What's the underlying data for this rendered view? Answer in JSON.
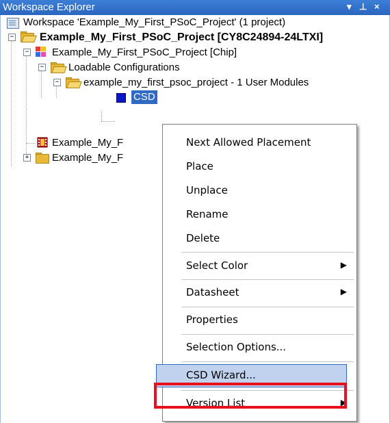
{
  "window": {
    "title": "Workspace Explorer",
    "pin_glyph": "▾",
    "dock_glyph": "p",
    "close_glyph": "×"
  },
  "tree": {
    "workspace": "Workspace 'Example_My_First_PSoC_Project' (1 project)",
    "project": "Example_My_First_PSoC_Project [CY8C24894-24LTXI]",
    "chip": "Example_My_First_PSoC_Project [Chip]",
    "loadable_configurations": "Loadable Configurations",
    "configuration": "example_my_first_psoc_project - 1 User Modules",
    "module": "CSD",
    "item_film": "Example_My_F",
    "item_folder": "Example_My_F"
  },
  "menu": {
    "items": [
      {
        "label": "Next Allowed Placement",
        "submenu": false
      },
      {
        "label": "Place",
        "submenu": false
      },
      {
        "label": "Unplace",
        "submenu": false
      },
      {
        "label": "Rename",
        "submenu": false
      },
      {
        "label": "Delete",
        "submenu": false
      },
      {
        "label": "Select Color",
        "submenu": true
      },
      {
        "label": "Datasheet",
        "submenu": true
      },
      {
        "label": "Properties",
        "submenu": false
      },
      {
        "label": "Selection Options...",
        "submenu": false
      },
      {
        "label": "CSD Wizard...",
        "submenu": false,
        "highlighted": true
      },
      {
        "label": "Version List",
        "submenu": true
      }
    ],
    "submenu_arrow": "▶"
  },
  "colors": {
    "titlebar": "#2a66c1",
    "selection": "#316ac5",
    "highlight": "#c1d2ee",
    "annotation_box": "#e8101e",
    "module_icon": "#0a18c8"
  }
}
